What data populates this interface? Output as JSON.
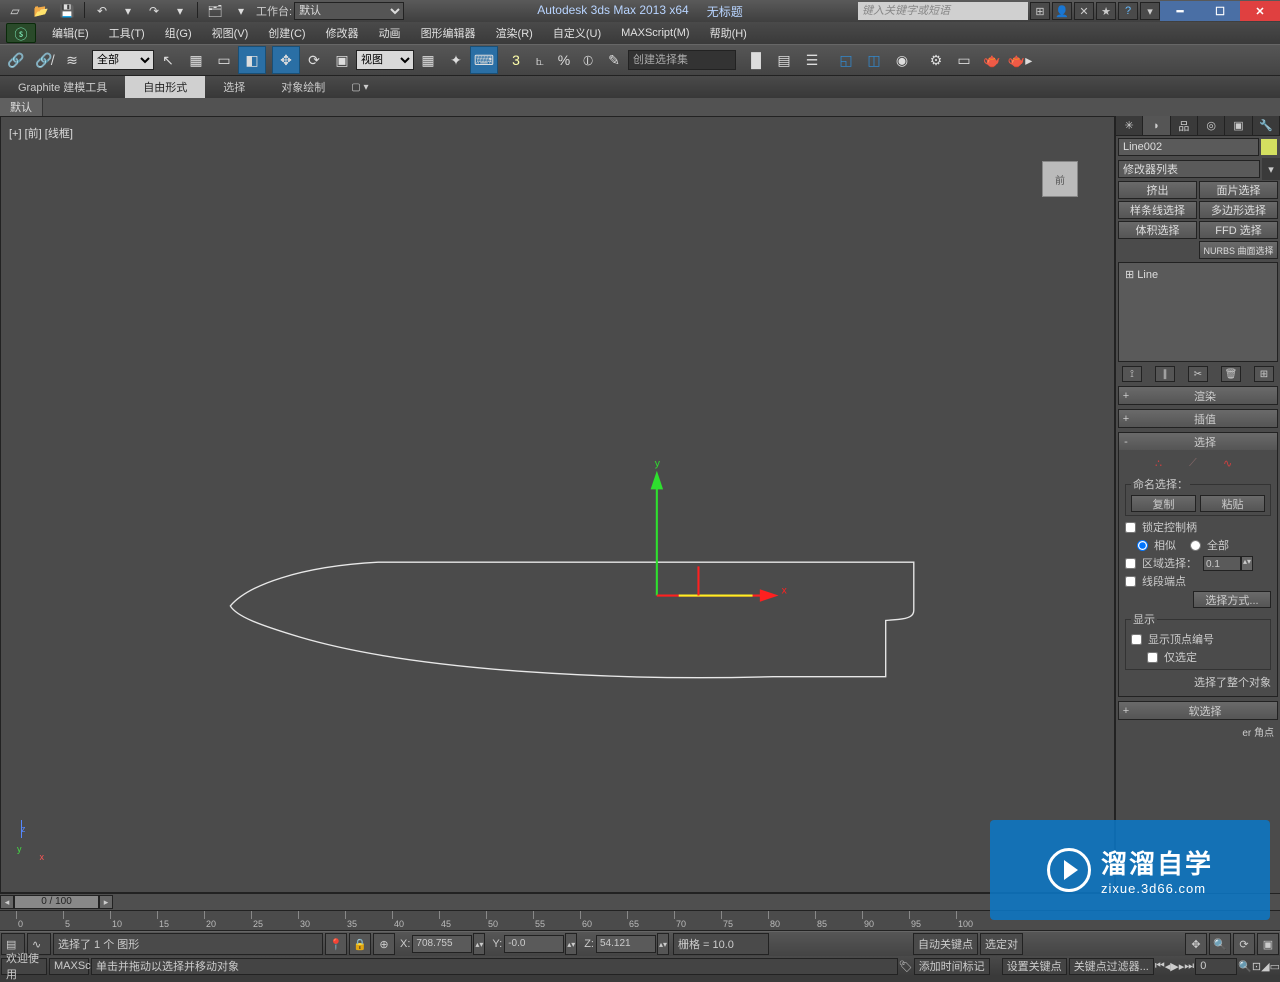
{
  "titlebar": {
    "workspace_label": "工作台:",
    "workspace_value": "默认",
    "app": "Autodesk 3ds Max  2013 x64",
    "doc": "无标题",
    "search_placeholder": "键入关键字或短语"
  },
  "menu": [
    "编辑(E)",
    "工具(T)",
    "组(G)",
    "视图(V)",
    "创建(C)",
    "修改器",
    "动画",
    "图形编辑器",
    "渲染(R)",
    "自定义(U)",
    "MAXScript(M)",
    "帮助(H)"
  ],
  "maintb": {
    "category": "全部",
    "view": "视图",
    "selset_placeholder": "创建选择集"
  },
  "ribbon": {
    "tabs": [
      "Graphite 建模工具",
      "自由形式",
      "选择",
      "对象绘制"
    ],
    "sub": "默认"
  },
  "viewport": {
    "label": "[+] [前] [线框]",
    "cube": "前",
    "axis": {
      "x": "x",
      "y": "y",
      "z": "z"
    }
  },
  "gizmo": {
    "y": "y",
    "x": "x"
  },
  "rpanel": {
    "name": "Line002",
    "modsel": "修改器列表",
    "buttons": [
      [
        "挤出",
        "面片选择"
      ],
      [
        "样条线选择",
        "多边形选择"
      ],
      [
        "体积选择",
        "FFD 选择"
      ]
    ],
    "nurbs": "NURBS 曲面选择",
    "modstack": "Line",
    "rollouts": {
      "render": "渲染",
      "interp": "插值",
      "sel": "选择",
      "softsel": "软选择",
      "named": "命名选择：",
      "copy": "复制",
      "paste": "粘贴",
      "lockhandles": "锁定控制柄",
      "similar": "相似",
      "all": "全部",
      "areasel": "区域选择：",
      "areaval": "0.1",
      "segend": "线段端点",
      "selmethod": "选择方式...",
      "display": "显示",
      "showvnum": "显示顶点编号",
      "onlysel": "仅选定",
      "selinfo": "选择了整个对象",
      "bezier": "er 角点"
    }
  },
  "timeline": {
    "pos": "0 / 100",
    "ticks": [
      "0",
      "5",
      "10",
      "15",
      "20",
      "25",
      "30",
      "35",
      "40",
      "45",
      "50",
      "55",
      "60",
      "65",
      "70",
      "75",
      "80",
      "85",
      "90",
      "95",
      "100"
    ]
  },
  "status": {
    "selinfo": "选择了 1 个 图形",
    "x": "708.755",
    "y": "-0.0",
    "z": "54.121",
    "grid": "栅格 = 10.0",
    "autokey": "自动关键点",
    "selonly": "选定对",
    "hint": "单击并拖动以选择并移动对象",
    "addmarker": "添加时间标记",
    "setkey": "设置关键点",
    "filter": "关键点过滤器...",
    "frame": "0",
    "welcome": "欢迎使用",
    "maxsc": "MAXSc"
  },
  "watermark": {
    "cn": "溜溜自学",
    "url": "zixue.3d66.com"
  }
}
